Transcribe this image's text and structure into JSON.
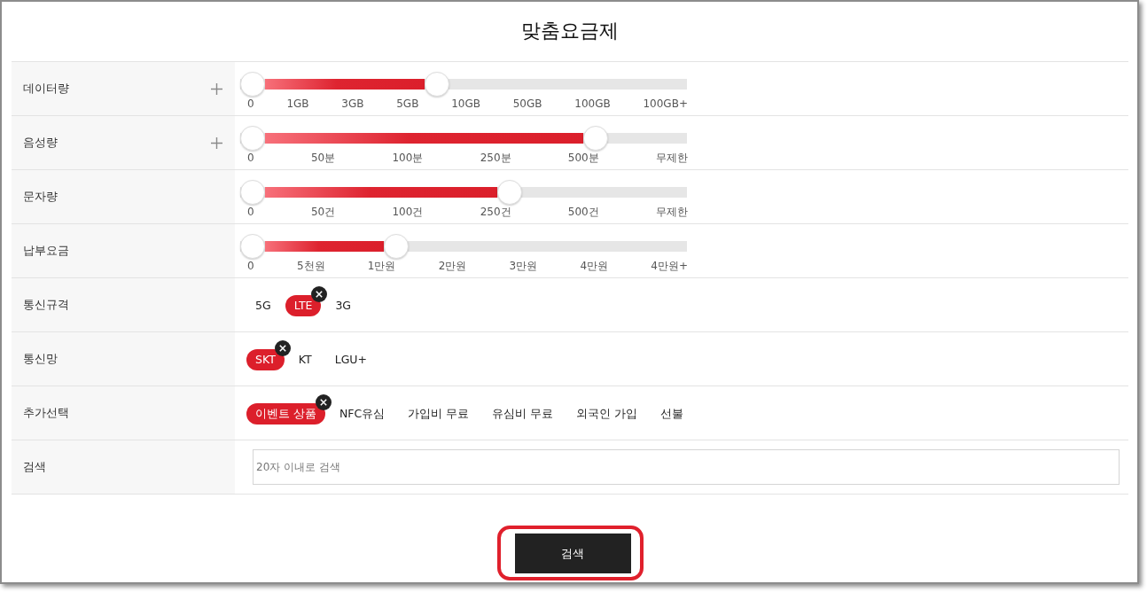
{
  "title": "맞춤요금제",
  "filters": [
    {
      "kind": "slider",
      "label": "데이터량",
      "expandable": true,
      "level": 0.43,
      "ticks": [
        "0",
        "1GB",
        "3GB",
        "5GB",
        "10GB",
        "50GB",
        "100GB",
        "100GB+"
      ]
    },
    {
      "kind": "slider",
      "label": "음성량",
      "expandable": true,
      "level": 0.8,
      "ticks": [
        "0",
        "50분",
        "100분",
        "250분",
        "500분",
        "무제한"
      ]
    },
    {
      "kind": "slider",
      "label": "문자량",
      "expandable": false,
      "level": 0.6,
      "ticks": [
        "0",
        "50건",
        "100건",
        "250건",
        "500건",
        "무제한"
      ]
    },
    {
      "kind": "slider",
      "label": "납부요금",
      "expandable": false,
      "level": 0.335,
      "ticks": [
        "0",
        "5천원",
        "1만원",
        "2만원",
        "3만원",
        "4만원",
        "4만원+"
      ]
    },
    {
      "kind": "chips",
      "label": "통신규격",
      "options": [
        {
          "label": "5G",
          "selected": false
        },
        {
          "label": "LTE",
          "selected": true
        },
        {
          "label": "3G",
          "selected": false
        }
      ]
    },
    {
      "kind": "chips",
      "label": "통신망",
      "options": [
        {
          "label": "SKT",
          "selected": true
        },
        {
          "label": "KT",
          "selected": false
        },
        {
          "label": "LGU+",
          "selected": false
        }
      ]
    },
    {
      "kind": "chips",
      "label": "추가선택",
      "options": [
        {
          "label": "이벤트 상품",
          "selected": true
        },
        {
          "label": "NFC유심",
          "selected": false
        },
        {
          "label": "가입비 무료",
          "selected": false
        },
        {
          "label": "유심비 무료",
          "selected": false
        },
        {
          "label": "외국인 가입",
          "selected": false
        },
        {
          "label": "선불",
          "selected": false
        }
      ]
    },
    {
      "kind": "search",
      "label": "검색",
      "placeholder": "20자 이내로 검색"
    }
  ],
  "search_button": {
    "label": "검색",
    "highlighted": true
  }
}
